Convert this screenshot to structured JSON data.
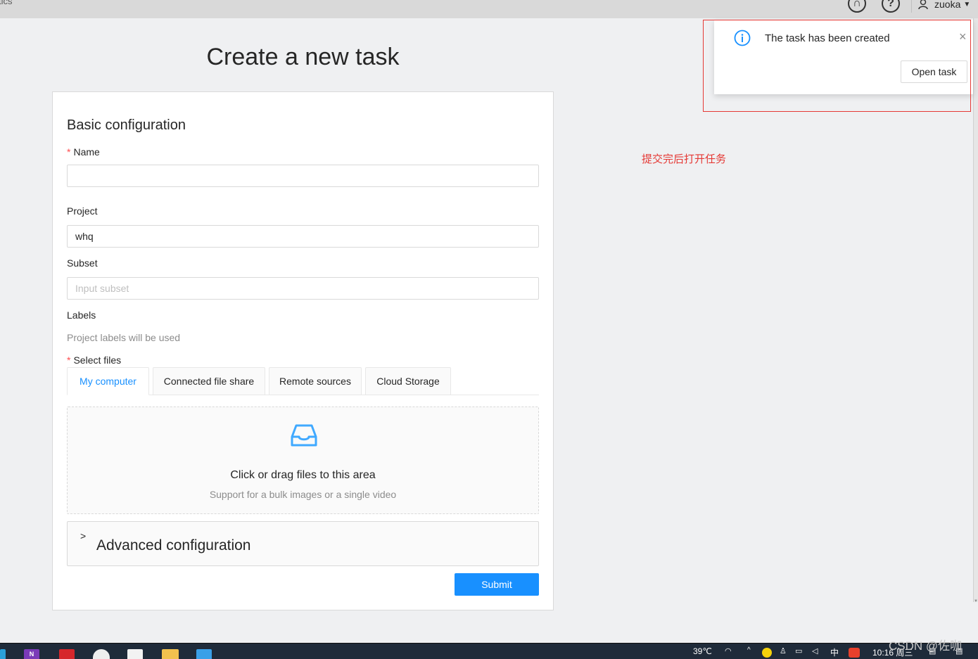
{
  "header": {
    "left_text": "tics",
    "github_icon": "github-icon",
    "help_icon": "question-circle-icon",
    "user_name": "zuoka"
  },
  "page_title": "Create a new task",
  "form": {
    "section_title": "Basic configuration",
    "name_label": "Name",
    "name_value": "",
    "project_label": "Project",
    "project_value": "whq",
    "subset_label": "Subset",
    "subset_placeholder": "Input subset",
    "labels_label": "Labels",
    "labels_hint": "Project labels will be used",
    "select_files_label": "Select files",
    "tabs": [
      {
        "label": "My computer",
        "active": true
      },
      {
        "label": "Connected file share",
        "active": false
      },
      {
        "label": "Remote sources",
        "active": false
      },
      {
        "label": "Cloud Storage",
        "active": false
      }
    ],
    "dropzone_text": "Click or drag files to this area",
    "dropzone_hint": "Support for a bulk images or a single video",
    "advanced_title": "Advanced configuration",
    "submit_label": "Submit"
  },
  "notification": {
    "message": "The task has been created",
    "close_glyph": "×",
    "action_label": "Open task"
  },
  "annotation": "提交完后打开任务",
  "taskbar": {
    "temperature": "39℃",
    "ime": "中",
    "time": "10:16 周三"
  },
  "watermark": "CSDN @佐咖",
  "colors": {
    "primary": "#1890ff",
    "required": "#ff4d4f",
    "annotation": "#e53935",
    "background": "#eff0f2"
  }
}
